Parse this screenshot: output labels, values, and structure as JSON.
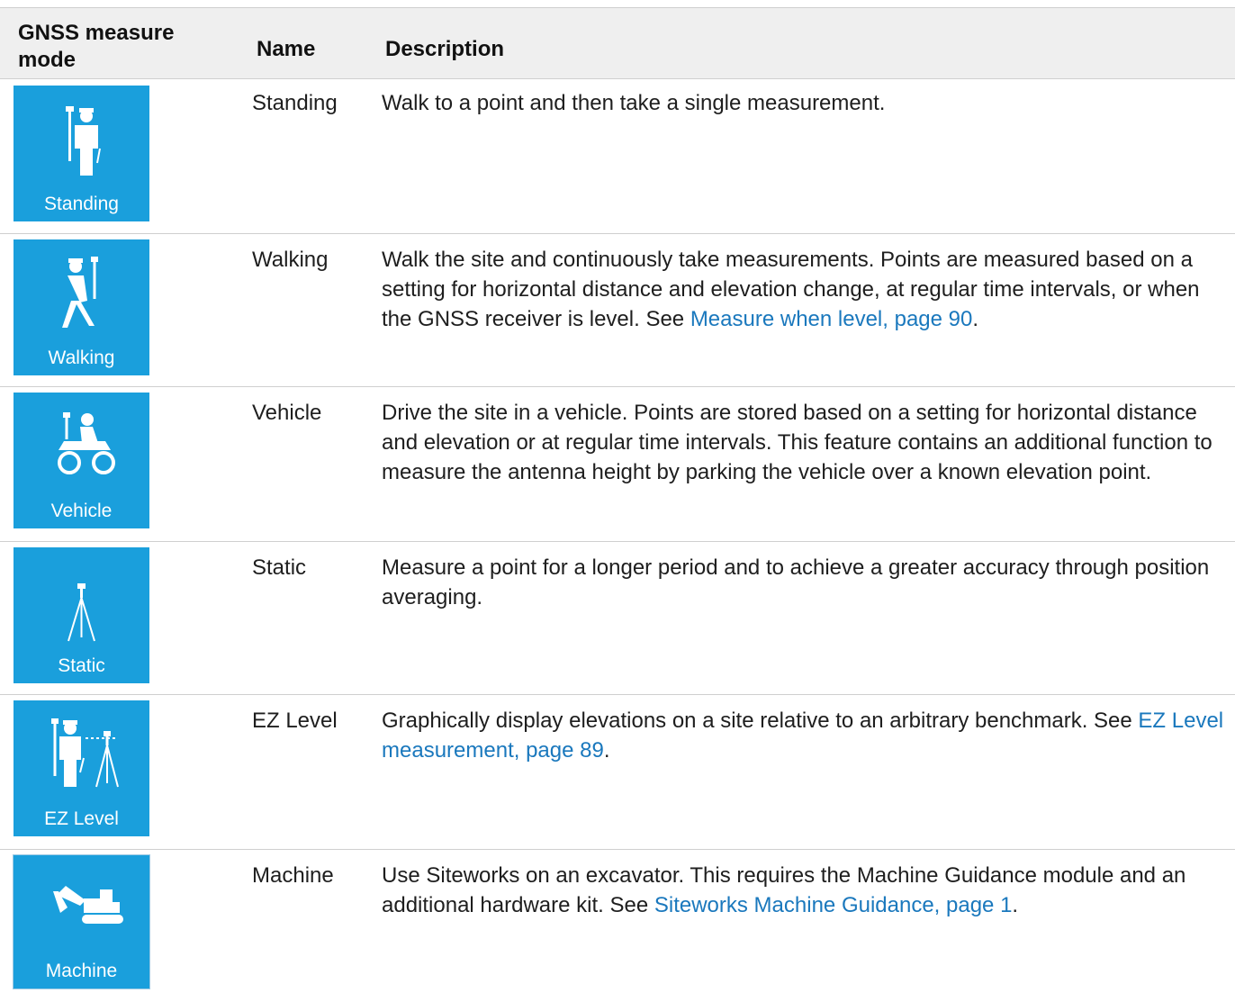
{
  "header": {
    "mode": "GNSS measure mode",
    "name": "Name",
    "description": "Description"
  },
  "rows": [
    {
      "icon": "standing-person-icon",
      "tile_caption": "Standing",
      "name": "Standing",
      "desc": "Walk to a point and then take a single measurement.",
      "link": "",
      "tail": ""
    },
    {
      "icon": "walking-person-icon",
      "tile_caption": "Walking",
      "name": "Walking",
      "desc": "Walk the site and continuously take measurements. Points are measured based on a setting for horizontal distance and elevation change, at regular time intervals, or when the GNSS receiver is level. See ",
      "link": "Measure when level, page 90",
      "tail": "."
    },
    {
      "icon": "atv-vehicle-icon",
      "tile_caption": "Vehicle",
      "name": "Vehicle",
      "desc": "Drive the site in a vehicle. Points are stored based on a setting for horizontal distance and elevation or at regular time intervals. This feature contains an additional function to measure the antenna height by parking the vehicle over a known elevation point.",
      "link": "",
      "tail": ""
    },
    {
      "icon": "tripod-icon",
      "tile_caption": "Static",
      "name": "Static",
      "desc": "Measure a point for a longer period and to achieve a greater accuracy through position averaging.",
      "link": "",
      "tail": ""
    },
    {
      "icon": "person-with-tripod-icon",
      "tile_caption": "EZ Level",
      "name": "EZ Level",
      "desc": "Graphically display elevations on a site relative to an arbitrary benchmark. See ",
      "link": "EZ Level measurement, page 89",
      "tail": "."
    },
    {
      "icon": "excavator-icon",
      "tile_caption": "Machine",
      "name": "Machine",
      "desc": "Use Siteworks on an excavator. This requires the Machine Guidance module and an additional hardware kit. See ",
      "link": "Siteworks Machine Guidance, page 1",
      "tail": "."
    }
  ],
  "colors": {
    "tile_blue": "#1a9fdc",
    "link_blue": "#1a78bd",
    "header_bg": "#efefef",
    "rule": "#cfcfcf"
  }
}
